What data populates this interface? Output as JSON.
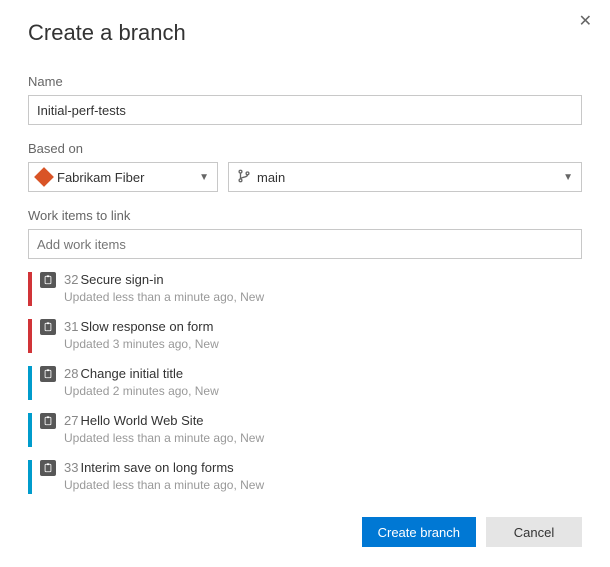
{
  "dialog": {
    "title": "Create a branch",
    "name_label": "Name",
    "name_value": "Initial-perf-tests",
    "based_on_label": "Based on",
    "repo": "Fabrikam Fiber",
    "branch": "main",
    "work_items_label": "Work items to link",
    "work_items_placeholder": "Add work items",
    "work_items": [
      {
        "id": "32",
        "title": "Secure sign-in",
        "sub": "Updated less than a minute ago, New",
        "color": "red"
      },
      {
        "id": "31",
        "title": "Slow response on form",
        "sub": "Updated 3 minutes ago, New",
        "color": "red"
      },
      {
        "id": "28",
        "title": "Change initial title",
        "sub": "Updated 2 minutes ago, New",
        "color": "blue"
      },
      {
        "id": "27",
        "title": "Hello World Web Site",
        "sub": "Updated less than a minute ago, New",
        "color": "blue"
      },
      {
        "id": "33",
        "title": "Interim save on long forms",
        "sub": "Updated less than a minute ago, New",
        "color": "blue"
      }
    ],
    "create_label": "Create branch",
    "cancel_label": "Cancel"
  }
}
